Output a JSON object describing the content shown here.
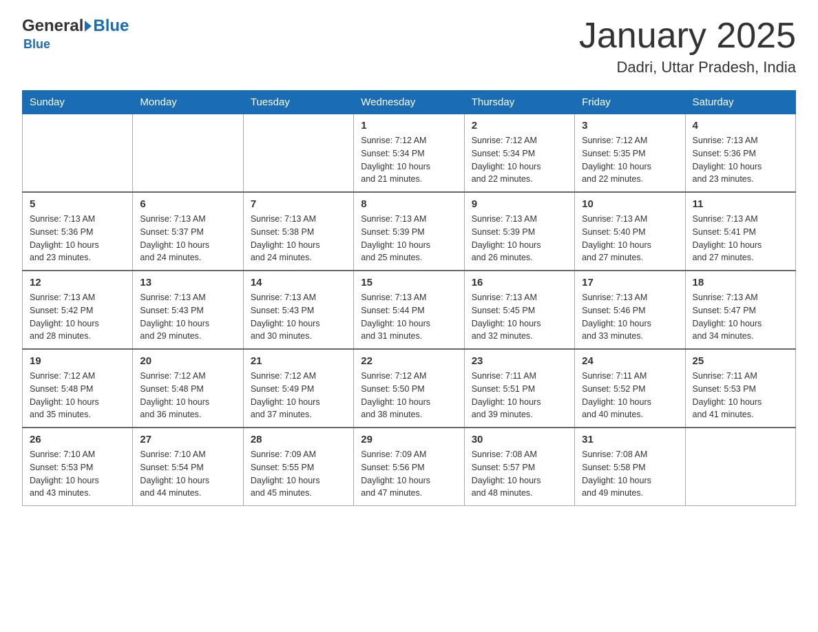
{
  "header": {
    "logo": {
      "text_general": "General",
      "text_blue": "Blue"
    },
    "month": "January 2025",
    "location": "Dadri, Uttar Pradesh, India"
  },
  "days_of_week": [
    "Sunday",
    "Monday",
    "Tuesday",
    "Wednesday",
    "Thursday",
    "Friday",
    "Saturday"
  ],
  "weeks": [
    {
      "cells": [
        {
          "day": "",
          "info": ""
        },
        {
          "day": "",
          "info": ""
        },
        {
          "day": "",
          "info": ""
        },
        {
          "day": "1",
          "info": "Sunrise: 7:12 AM\nSunset: 5:34 PM\nDaylight: 10 hours\nand 21 minutes."
        },
        {
          "day": "2",
          "info": "Sunrise: 7:12 AM\nSunset: 5:34 PM\nDaylight: 10 hours\nand 22 minutes."
        },
        {
          "day": "3",
          "info": "Sunrise: 7:12 AM\nSunset: 5:35 PM\nDaylight: 10 hours\nand 22 minutes."
        },
        {
          "day": "4",
          "info": "Sunrise: 7:13 AM\nSunset: 5:36 PM\nDaylight: 10 hours\nand 23 minutes."
        }
      ]
    },
    {
      "cells": [
        {
          "day": "5",
          "info": "Sunrise: 7:13 AM\nSunset: 5:36 PM\nDaylight: 10 hours\nand 23 minutes."
        },
        {
          "day": "6",
          "info": "Sunrise: 7:13 AM\nSunset: 5:37 PM\nDaylight: 10 hours\nand 24 minutes."
        },
        {
          "day": "7",
          "info": "Sunrise: 7:13 AM\nSunset: 5:38 PM\nDaylight: 10 hours\nand 24 minutes."
        },
        {
          "day": "8",
          "info": "Sunrise: 7:13 AM\nSunset: 5:39 PM\nDaylight: 10 hours\nand 25 minutes."
        },
        {
          "day": "9",
          "info": "Sunrise: 7:13 AM\nSunset: 5:39 PM\nDaylight: 10 hours\nand 26 minutes."
        },
        {
          "day": "10",
          "info": "Sunrise: 7:13 AM\nSunset: 5:40 PM\nDaylight: 10 hours\nand 27 minutes."
        },
        {
          "day": "11",
          "info": "Sunrise: 7:13 AM\nSunset: 5:41 PM\nDaylight: 10 hours\nand 27 minutes."
        }
      ]
    },
    {
      "cells": [
        {
          "day": "12",
          "info": "Sunrise: 7:13 AM\nSunset: 5:42 PM\nDaylight: 10 hours\nand 28 minutes."
        },
        {
          "day": "13",
          "info": "Sunrise: 7:13 AM\nSunset: 5:43 PM\nDaylight: 10 hours\nand 29 minutes."
        },
        {
          "day": "14",
          "info": "Sunrise: 7:13 AM\nSunset: 5:43 PM\nDaylight: 10 hours\nand 30 minutes."
        },
        {
          "day": "15",
          "info": "Sunrise: 7:13 AM\nSunset: 5:44 PM\nDaylight: 10 hours\nand 31 minutes."
        },
        {
          "day": "16",
          "info": "Sunrise: 7:13 AM\nSunset: 5:45 PM\nDaylight: 10 hours\nand 32 minutes."
        },
        {
          "day": "17",
          "info": "Sunrise: 7:13 AM\nSunset: 5:46 PM\nDaylight: 10 hours\nand 33 minutes."
        },
        {
          "day": "18",
          "info": "Sunrise: 7:13 AM\nSunset: 5:47 PM\nDaylight: 10 hours\nand 34 minutes."
        }
      ]
    },
    {
      "cells": [
        {
          "day": "19",
          "info": "Sunrise: 7:12 AM\nSunset: 5:48 PM\nDaylight: 10 hours\nand 35 minutes."
        },
        {
          "day": "20",
          "info": "Sunrise: 7:12 AM\nSunset: 5:48 PM\nDaylight: 10 hours\nand 36 minutes."
        },
        {
          "day": "21",
          "info": "Sunrise: 7:12 AM\nSunset: 5:49 PM\nDaylight: 10 hours\nand 37 minutes."
        },
        {
          "day": "22",
          "info": "Sunrise: 7:12 AM\nSunset: 5:50 PM\nDaylight: 10 hours\nand 38 minutes."
        },
        {
          "day": "23",
          "info": "Sunrise: 7:11 AM\nSunset: 5:51 PM\nDaylight: 10 hours\nand 39 minutes."
        },
        {
          "day": "24",
          "info": "Sunrise: 7:11 AM\nSunset: 5:52 PM\nDaylight: 10 hours\nand 40 minutes."
        },
        {
          "day": "25",
          "info": "Sunrise: 7:11 AM\nSunset: 5:53 PM\nDaylight: 10 hours\nand 41 minutes."
        }
      ]
    },
    {
      "cells": [
        {
          "day": "26",
          "info": "Sunrise: 7:10 AM\nSunset: 5:53 PM\nDaylight: 10 hours\nand 43 minutes."
        },
        {
          "day": "27",
          "info": "Sunrise: 7:10 AM\nSunset: 5:54 PM\nDaylight: 10 hours\nand 44 minutes."
        },
        {
          "day": "28",
          "info": "Sunrise: 7:09 AM\nSunset: 5:55 PM\nDaylight: 10 hours\nand 45 minutes."
        },
        {
          "day": "29",
          "info": "Sunrise: 7:09 AM\nSunset: 5:56 PM\nDaylight: 10 hours\nand 47 minutes."
        },
        {
          "day": "30",
          "info": "Sunrise: 7:08 AM\nSunset: 5:57 PM\nDaylight: 10 hours\nand 48 minutes."
        },
        {
          "day": "31",
          "info": "Sunrise: 7:08 AM\nSunset: 5:58 PM\nDaylight: 10 hours\nand 49 minutes."
        },
        {
          "day": "",
          "info": ""
        }
      ]
    }
  ]
}
